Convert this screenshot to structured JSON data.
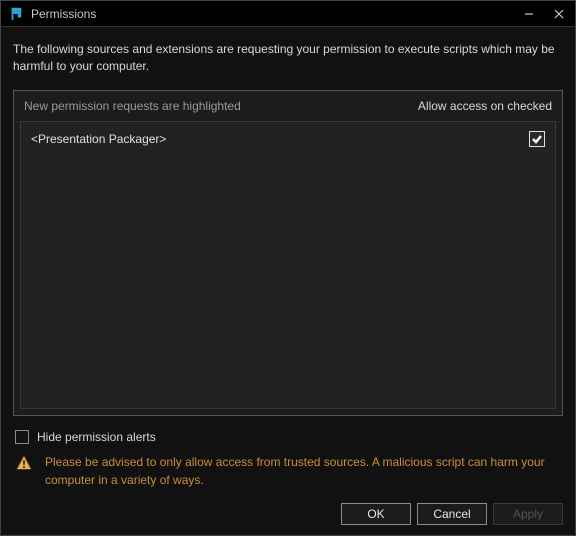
{
  "window": {
    "title": "Permissions"
  },
  "intro": "The following sources and extensions are requesting your permission to execute scripts which may be harmful to your computer.",
  "panel": {
    "hint": "New permission requests are highlighted",
    "action_label": "Allow access on checked"
  },
  "requests": [
    {
      "label": "<Presentation Packager>",
      "checked": true
    }
  ],
  "hide_alerts": {
    "label": "Hide permission alerts",
    "checked": false
  },
  "warning": "Please be advised to only allow access from trusted sources. A malicious script can harm your computer in a variety of ways.",
  "buttons": {
    "ok": "OK",
    "cancel": "Cancel",
    "apply": "Apply"
  }
}
